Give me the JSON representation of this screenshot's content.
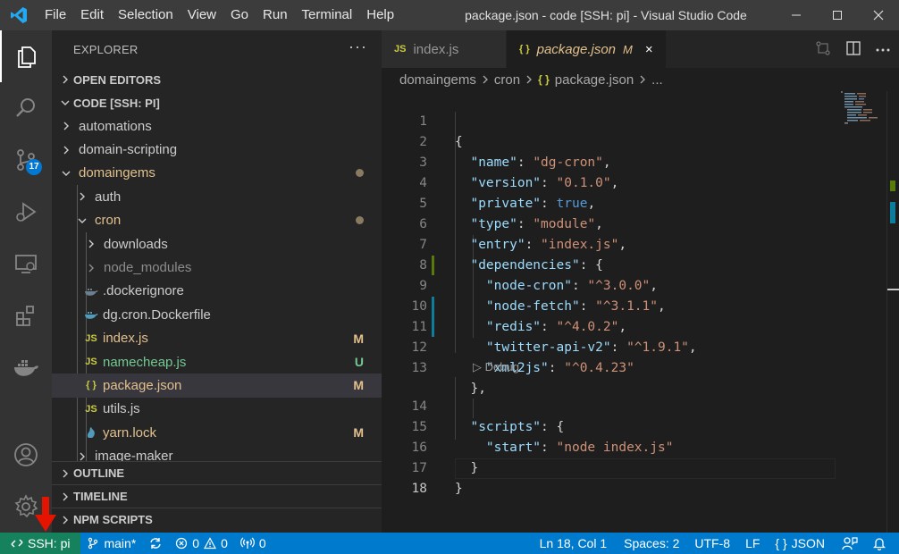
{
  "titlebar": {
    "menu": [
      "File",
      "Edit",
      "Selection",
      "View",
      "Go",
      "Run",
      "Terminal",
      "Help"
    ],
    "title": "package.json - code [SSH: pi] - Visual Studio Code",
    "logo_icon": "vscode-logo-icon"
  },
  "activitybar": {
    "scm_badge": "17",
    "items": [
      "explorer-icon",
      "search-icon",
      "source-control-icon",
      "run-debug-icon",
      "remote-explorer-icon",
      "extensions-icon",
      "docker-icon",
      "account-icon",
      "settings-gear-icon"
    ]
  },
  "sidebar": {
    "title": "EXPLORER",
    "more": "···",
    "open_editors": "OPEN EDITORS",
    "workspace": "CODE [SSH: PI]",
    "tree": [
      {
        "label": "automations",
        "kind": "folder",
        "open": false
      },
      {
        "label": "domain-scripting",
        "kind": "folder",
        "open": false
      },
      {
        "label": "domaingems",
        "kind": "folder",
        "open": true
      },
      {
        "label": "auth",
        "kind": "folder",
        "open": false
      },
      {
        "label": "cron",
        "kind": "folder",
        "open": true
      },
      {
        "label": "downloads",
        "kind": "folder",
        "open": false
      },
      {
        "label": "node_modules",
        "kind": "folder",
        "open": false
      },
      {
        "label": ".dockerignore",
        "kind": "docker"
      },
      {
        "label": "dg.cron.Dockerfile",
        "kind": "docker"
      },
      {
        "label": "index.js",
        "kind": "js",
        "status": "M"
      },
      {
        "label": "namecheap.js",
        "kind": "js",
        "status": "U"
      },
      {
        "label": "package.json",
        "kind": "json",
        "status": "M"
      },
      {
        "label": "utils.js",
        "kind": "js"
      },
      {
        "label": "yarn.lock",
        "kind": "yarn",
        "status": "M"
      },
      {
        "label": "image-maker",
        "kind": "folder",
        "open": false
      }
    ],
    "outline": "OUTLINE",
    "timeline": "TIMELINE",
    "npm_scripts": "NPM SCRIPTS"
  },
  "tabs": [
    {
      "icon": "JS",
      "label": "index.js",
      "active": false
    },
    {
      "icon": "{ }",
      "label": "package.json",
      "modified": "M",
      "close": "×",
      "active": true
    }
  ],
  "breadcrumbs": [
    "domaingems",
    "cron",
    "package.json",
    "..."
  ],
  "breadcrumb_json_icon": "{ }",
  "editor": {
    "current_line": 18,
    "codelens": "▷ Debug",
    "lines": [
      {
        "n": "1"
      },
      {
        "n": "2"
      },
      {
        "n": "3"
      },
      {
        "n": "4"
      },
      {
        "n": "5"
      },
      {
        "n": "6"
      },
      {
        "n": "7"
      },
      {
        "n": "8"
      },
      {
        "n": "9"
      },
      {
        "n": "10"
      },
      {
        "n": "11"
      },
      {
        "n": "12"
      },
      {
        "n": "13"
      },
      {
        "n": "14"
      },
      {
        "n": "15"
      },
      {
        "n": "16"
      },
      {
        "n": "17"
      },
      {
        "n": "18"
      }
    ],
    "json": {
      "name_key": "\"name\"",
      "name_val": "\"dg-cron\"",
      "version_key": "\"version\"",
      "version_val": "\"0.1.0\"",
      "private_key": "\"private\"",
      "private_val": "true",
      "type_key": "\"type\"",
      "type_val": "\"module\"",
      "entry_key": "\"entry\"",
      "entry_val": "\"index.js\"",
      "deps_key": "\"dependencies\"",
      "d1_key": "\"node-cron\"",
      "d1_val": "\"^3.0.0\"",
      "d2_key": "\"node-fetch\"",
      "d2_val": "\"^3.1.1\"",
      "d3_key": "\"redis\"",
      "d3_val": "\"^4.0.2\"",
      "d4_key": "\"twitter-api-v2\"",
      "d4_val": "\"^1.9.1\"",
      "d5_key": "\"xml2js\"",
      "d5_val": "\"^0.4.23\"",
      "scripts_key": "\"scripts\"",
      "start_key": "\"start\"",
      "start_val": "\"node index.js\""
    }
  },
  "statusbar": {
    "remote": "SSH: pi",
    "branch": "main*",
    "errors": "0",
    "warnings": "0",
    "ports": "0",
    "position": "Ln 18, Col 1",
    "spaces": "Spaces: 2",
    "encoding": "UTF-8",
    "eol": "LF",
    "language": "JSON",
    "language_icon": "{ }"
  },
  "colors": {
    "accent": "#007acc",
    "remote": "#16825d",
    "modified": "#e2c08d",
    "untracked": "#73c991",
    "annotation_arrow": "#e51400"
  }
}
